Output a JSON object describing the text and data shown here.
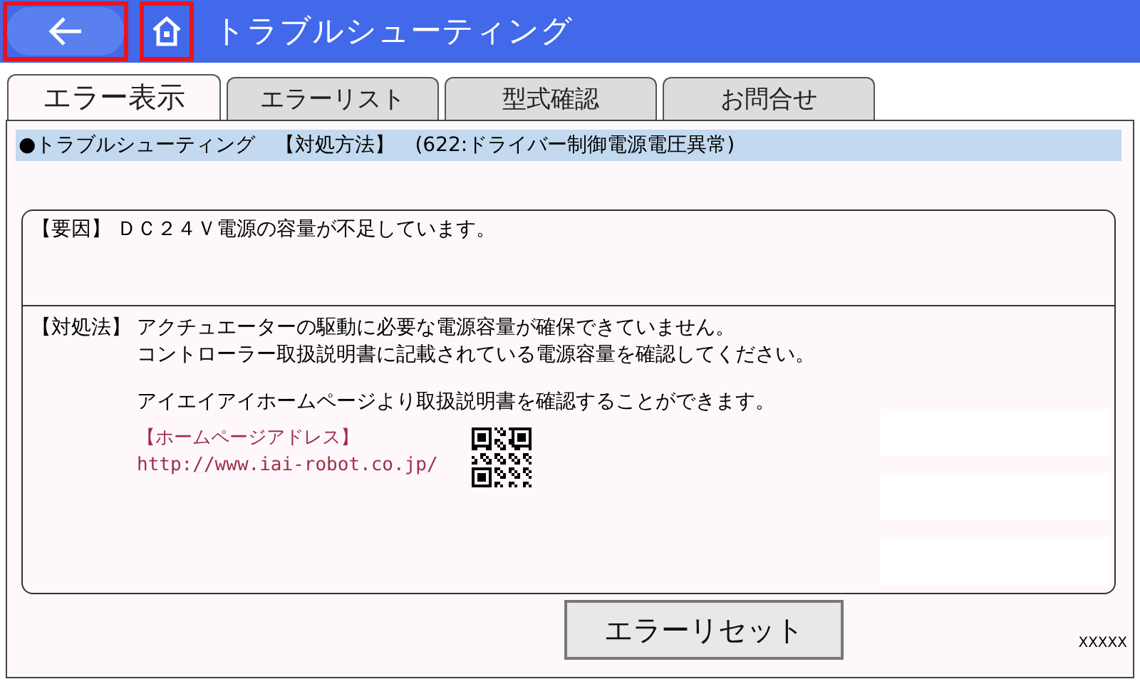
{
  "header": {
    "title": "トラブルシューティング",
    "highlighted": true
  },
  "tabs": [
    {
      "label": "エラー表示",
      "selected": true
    },
    {
      "label": "エラーリスト",
      "selected": false
    },
    {
      "label": "型式確認",
      "selected": false
    },
    {
      "label": "お問合せ",
      "selected": false
    }
  ],
  "heading": "●トラブルシューティング　【対処方法】　(622:ドライバー制御電源電圧異常)",
  "cause": {
    "label": "【要因】",
    "text": "ＤＣ２４Ｖ電源の容量が不足しています。"
  },
  "remedy": {
    "label": "【対処法】",
    "lines": [
      "アクチュエーターの駆動に必要な電源容量が確保できていません。",
      "コントローラー取扱説明書に記載されている電源容量を確認してください。"
    ],
    "note": "アイエイアイホームページより取扱説明書を確認することができます。",
    "link_label": "【ホームページアドレス】",
    "url": "http://www.iai-robot.co.jp/"
  },
  "reset_button": "エラーリセット",
  "footer_code": "XXXXX"
}
